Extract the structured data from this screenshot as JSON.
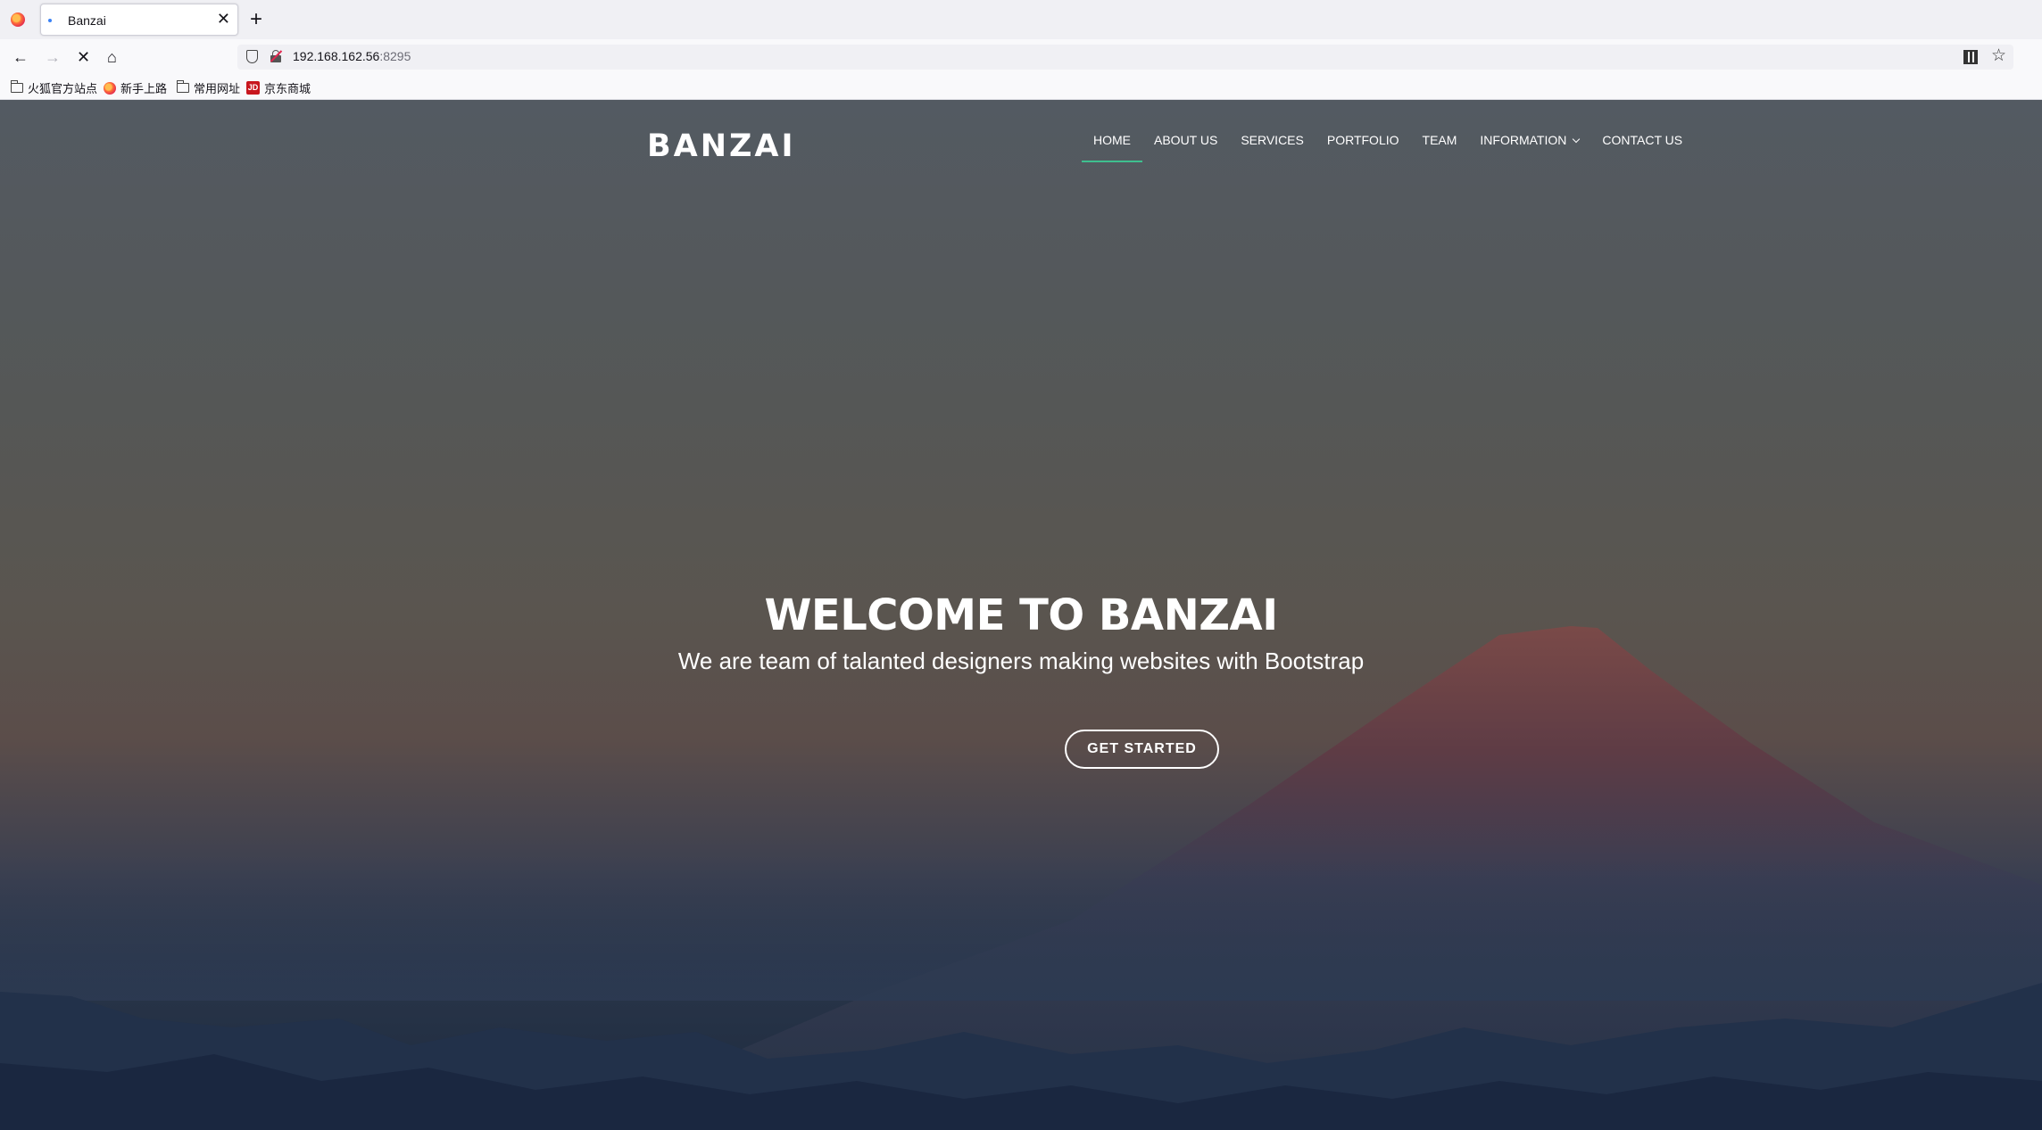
{
  "browser": {
    "tab_title": "Banzai",
    "tab_close": "✕",
    "new_tab": "+",
    "url_host": "192.168.162.56",
    "url_port": ":8295",
    "nav": {
      "back": "←",
      "forward": "→",
      "stop": "✕",
      "home": "⌂"
    },
    "star": "☆",
    "bookmarks": [
      {
        "label": "火狐官方站点",
        "icon": "folder-icon"
      },
      {
        "label": "新手上路",
        "icon": "firefox-icon"
      },
      {
        "label": "常用网址",
        "icon": "folder-icon"
      },
      {
        "label": "京东商城",
        "icon": "jd-icon"
      }
    ],
    "jd_icon_text": "JD"
  },
  "site": {
    "brand": "BANZAI",
    "menu": [
      {
        "label": "HOME",
        "active": true
      },
      {
        "label": "ABOUT US"
      },
      {
        "label": "SERVICES"
      },
      {
        "label": "PORTFOLIO"
      },
      {
        "label": "TEAM"
      },
      {
        "label": "INFORMATION",
        "dropdown": true
      },
      {
        "label": "CONTACT US"
      }
    ],
    "hero": {
      "title": "WELCOME TO BANZAI",
      "subtitle": "We are team of talanted designers making websites with Bootstrap",
      "button": "GET STARTED"
    },
    "colors": {
      "accent": "#3fbf8f",
      "text": "#ffffff"
    }
  }
}
